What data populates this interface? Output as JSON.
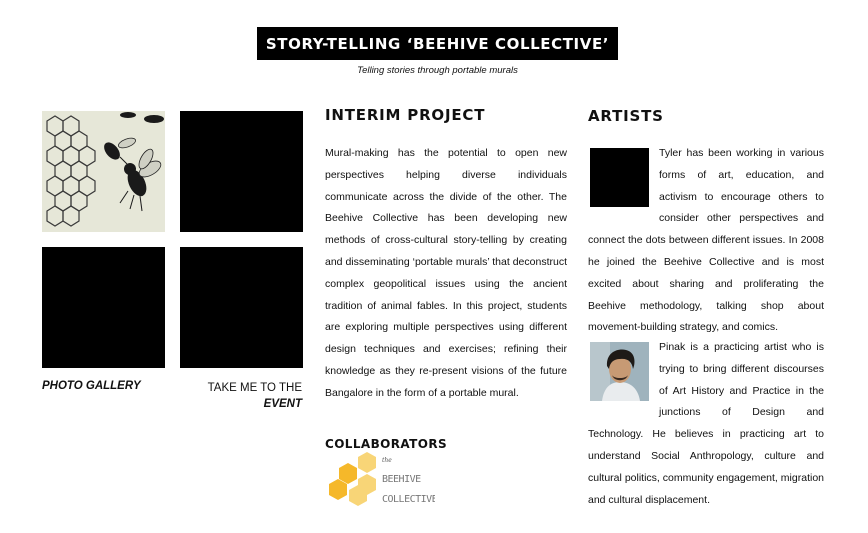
{
  "header": {
    "title": "STORY-TELLING ‘BEEHIVE COLLECTIVE’",
    "subtitle": "Telling stories through portable murals"
  },
  "gallery": {
    "photo_gallery_label": "PHOTO GALLERY",
    "event_link_line1": "TAKE ME TO THE",
    "event_link_line2": "EVENT"
  },
  "interim": {
    "heading": "INTERIM PROJECT",
    "text": "Mural-making has the potential to open new perspectives helping diverse individuals communicate across the divide of the other. The Beehive Collective has been developing new methods of cross-cultural story-telling by creating and disseminating ‘portable murals’ that deconstruct complex geopolitical issues using the ancient tradition of animal fables. In this project, students are exploring multiple perspectives using different design techniques and exercises; refining their knowledge as they re-present visions of the future Bangalore in the form of a portable mural."
  },
  "collaborators": {
    "heading": "COLLABORATORS",
    "logo_text_small": "the",
    "logo_text_line1": "BEEHIVE",
    "logo_text_line2": "COLLECTIVE",
    "logo_color": "#f5c342"
  },
  "artists": {
    "heading": "ARTISTS",
    "items": [
      {
        "text": "Tyler has been working in various forms of art, education, and activism to encourage others to consider other perspectives and connect the dots between different issues.  In 2008 he joined the Beehive Collective and is most excited about sharing and proliferating the Beehive methodology, talking shop about movement-building strategy, and comics."
      },
      {
        "text": "Pinak is a practicing artist who is trying to bring different discourses of Art History and Practice in the junctions of Design and Technology. He believes in practicing art to understand Social Anthropology, culture and cultural politics, community engagement, migration and cultural displacement."
      }
    ]
  }
}
